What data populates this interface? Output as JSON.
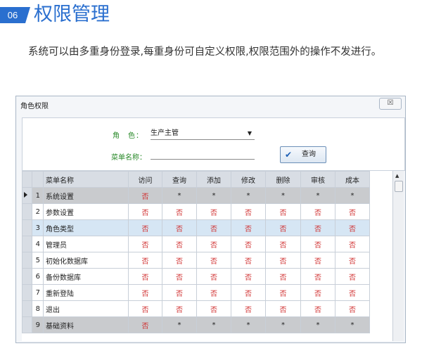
{
  "header": {
    "number": "06",
    "title": "权限管理"
  },
  "description": {
    "text": "系统可以由多重身份登录,每重身份可自定义权限,权限范围外的操作不发进行。"
  },
  "dialog": {
    "title": "角色权限",
    "close_label": "☒",
    "form": {
      "role_label": "角　色：",
      "role_value": "生产主管",
      "menu_label": "菜单名称：",
      "menu_value": "",
      "query_label": "查询"
    },
    "grid": {
      "columns": [
        "菜单名称",
        "访问",
        "查询",
        "添加",
        "修改",
        "删除",
        "审核",
        "成本"
      ],
      "rows": [
        {
          "no": "1",
          "name": "系统设置",
          "cells": [
            "否",
            "*",
            "*",
            "*",
            "*",
            "*",
            "*"
          ],
          "style": "gray",
          "current": true
        },
        {
          "no": "2",
          "name": "参数设置",
          "cells": [
            "否",
            "否",
            "否",
            "否",
            "否",
            "否",
            "否"
          ],
          "style": "white"
        },
        {
          "no": "3",
          "name": "角色类型",
          "cells": [
            "否",
            "否",
            "否",
            "否",
            "否",
            "否",
            "否"
          ],
          "style": "blue"
        },
        {
          "no": "4",
          "name": "管理员",
          "cells": [
            "否",
            "否",
            "否",
            "否",
            "否",
            "否",
            "否"
          ],
          "style": "white"
        },
        {
          "no": "5",
          "name": "初始化数据库",
          "cells": [
            "否",
            "否",
            "否",
            "否",
            "否",
            "否",
            "否"
          ],
          "style": "white"
        },
        {
          "no": "6",
          "name": "备份数据库",
          "cells": [
            "否",
            "否",
            "否",
            "否",
            "否",
            "否",
            "否"
          ],
          "style": "white"
        },
        {
          "no": "7",
          "name": "重新登陆",
          "cells": [
            "否",
            "否",
            "否",
            "否",
            "否",
            "否",
            "否"
          ],
          "style": "white"
        },
        {
          "no": "8",
          "name": "退出",
          "cells": [
            "否",
            "否",
            "否",
            "否",
            "否",
            "否",
            "否"
          ],
          "style": "white"
        },
        {
          "no": "9",
          "name": "基础资料",
          "cells": [
            "否",
            "*",
            "*",
            "*",
            "*",
            "*",
            "*"
          ],
          "style": "gray"
        }
      ]
    }
  },
  "colors": {
    "accent": "#2a6fcf",
    "no_value": "#d03030",
    "label_green": "#2a8a2a"
  }
}
